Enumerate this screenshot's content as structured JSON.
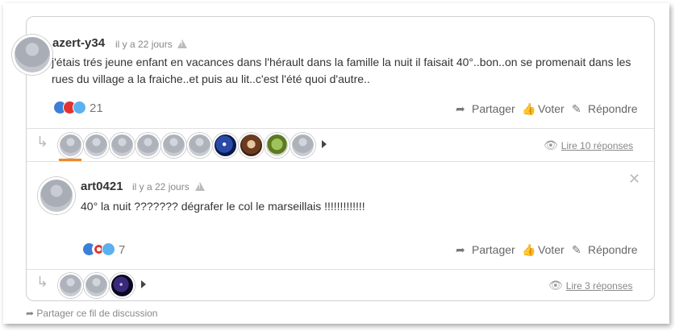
{
  "comments": [
    {
      "username": "azert-y34",
      "time": "il y a 22 jours",
      "text": "j'étais trés jeune enfant en vacances dans l'hérault dans la famille la nuit il faisait 40°..bon..on se promenait dans les rues du village a la fraiche..et puis au lit..c'est l'été quoi d'autre..",
      "reaction_count": "21",
      "actions": {
        "share": "Partager",
        "vote": "Voter",
        "reply": "Répondre"
      },
      "replies_link": "Lire 10 réponses"
    },
    {
      "username": "art0421",
      "time": "il y a 22 jours",
      "text": "40° la nuit ??????? dégrafer le col le marseillais !!!!!!!!!!!!!",
      "reaction_count": "7",
      "actions": {
        "share": "Partager",
        "vote": "Voter",
        "reply": "Répondre"
      },
      "replies_link": "Lire 3 réponses"
    }
  ],
  "footer": {
    "share_thread": "Partager ce fil de discussion"
  },
  "colors": {
    "accent": "#f08a24",
    "link": "#888888"
  },
  "icons": [
    "warning-icon",
    "share-icon",
    "thumbs-up-icon",
    "reply-icon",
    "eye-icon",
    "close-icon",
    "reply-arrow-icon",
    "chevron-right-icon"
  ]
}
